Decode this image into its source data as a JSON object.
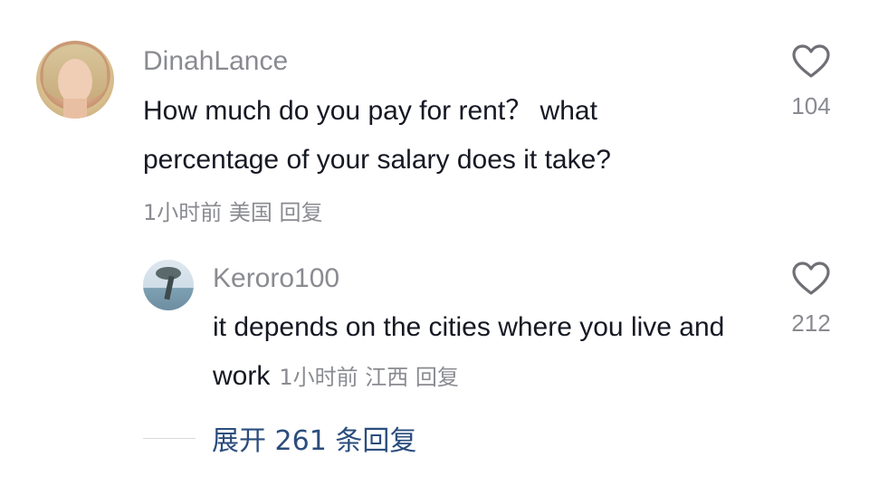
{
  "comments": [
    {
      "username": "DinahLance",
      "text": "How much do you pay for rent？ what percentage of your salary does it take?",
      "meta": "1小时前 美国 回复",
      "likes": "104",
      "avatar_icon": "user-avatar-photo"
    }
  ],
  "reply": {
    "username": "Keroro100",
    "text": "it depends on the cities where you live and work",
    "meta": "1小时前 江西 回复",
    "likes": "212",
    "avatar_icon": "user-avatar-photo"
  },
  "expand": {
    "label": "展开 261 条回复"
  },
  "colors": {
    "text": "#161823",
    "muted": "#8a8b91",
    "link": "#2b4d7d"
  },
  "icons": {
    "like": "heart-outline-icon"
  }
}
